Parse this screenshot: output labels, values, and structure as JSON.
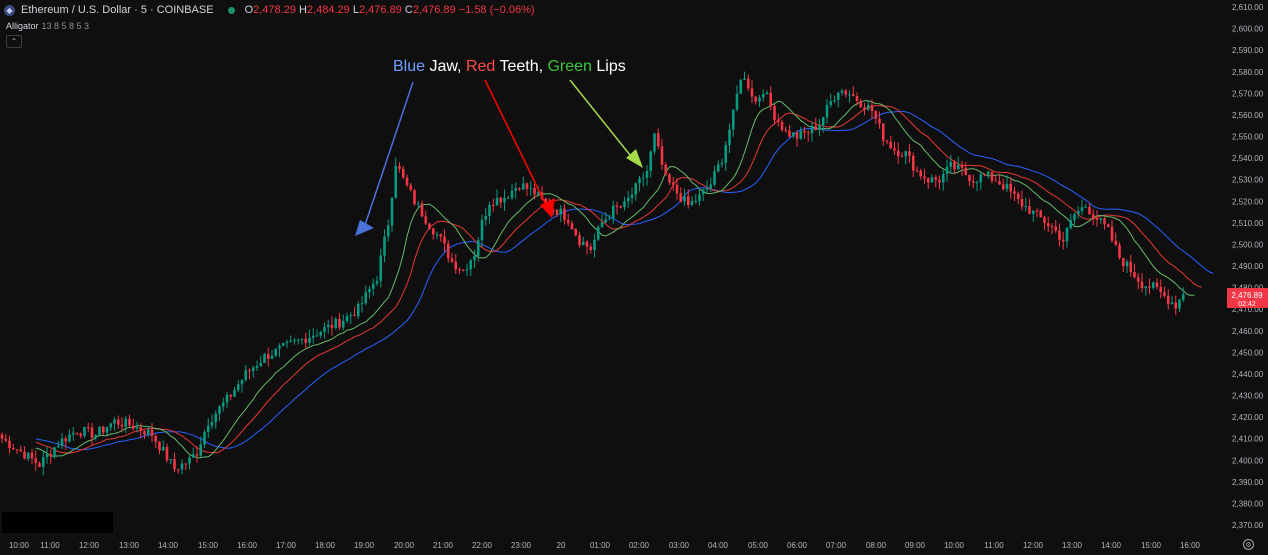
{
  "header": {
    "symbol_icon": "ethereum-icon",
    "symbol": "Ethereum / U.S. Dollar · 5 · COINBASE",
    "open_label": "O",
    "open": "2,478.29",
    "high_label": "H",
    "high": "2,484.29",
    "low_label": "L",
    "low": "2,476.89",
    "close_label": "C",
    "close": "2,476.89",
    "change": "−1.58 (−0.06%)"
  },
  "indicator": {
    "name": "Alligator",
    "params": "13 8 5 8 5 3"
  },
  "annotation": {
    "blue_word": "Blue",
    "jaw": " Jaw, ",
    "red_word": "Red",
    "teeth": " Teeth, ",
    "green_word": "Green",
    "lips": " Lips"
  },
  "price_tag": {
    "price": "2,476.89",
    "countdown": "02:42"
  },
  "colors": {
    "background": "#0f0f0f",
    "up": "#089981",
    "down": "#f23645",
    "jaw": "#2962ff",
    "teeth": "#e53935",
    "lips": "#66bb6a",
    "arrow_blue": "#4a72d8",
    "arrow_red": "#ff0000",
    "arrow_green": "#a6d84a"
  },
  "chart_data": {
    "type": "candlestick",
    "y_ticks": [
      "2,610.00",
      "2,600.00",
      "2,590.00",
      "2,580.00",
      "2,570.00",
      "2,560.00",
      "2,550.00",
      "2,540.00",
      "2,530.00",
      "2,520.00",
      "2,510.00",
      "2,500.00",
      "2,490.00",
      "2,480.00",
      "2,470.00",
      "2,460.00",
      "2,450.00",
      "2,440.00",
      "2,430.00",
      "2,420.00",
      "2,410.00",
      "2,400.00",
      "2,390.00",
      "2,380.00",
      "2,370.00"
    ],
    "x_ticks": [
      "10:00",
      "11:00",
      "12:00",
      "13:00",
      "14:00",
      "15:00",
      "16:00",
      "17:00",
      "18:00",
      "19:00",
      "20:00",
      "21:00",
      "22:00",
      "23:00",
      "20",
      "01:00",
      "02:00",
      "03:00",
      "04:00",
      "05:00",
      "06:00",
      "07:00",
      "08:00",
      "09:00",
      "10:00",
      "11:00",
      "12:00",
      "13:00",
      "14:00",
      "15:00",
      "16:00"
    ],
    "ylim": [
      2370,
      2610
    ],
    "close_path": [
      [
        0,
        2410
      ],
      [
        5,
        2404
      ],
      [
        10,
        2398
      ],
      [
        15,
        2408
      ],
      [
        20,
        2414
      ],
      [
        25,
        2412
      ],
      [
        30,
        2418
      ],
      [
        35,
        2416
      ],
      [
        40,
        2412
      ],
      [
        43,
        2404
      ],
      [
        46,
        2396
      ],
      [
        50,
        2400
      ],
      [
        52,
        2404
      ],
      [
        55,
        2418
      ],
      [
        60,
        2428
      ],
      [
        65,
        2440
      ],
      [
        70,
        2448
      ],
      [
        75,
        2452
      ],
      [
        80,
        2456
      ],
      [
        85,
        2460
      ],
      [
        90,
        2464
      ],
      [
        95,
        2470
      ],
      [
        100,
        2485
      ],
      [
        103,
        2510
      ],
      [
        105,
        2538
      ],
      [
        107,
        2530
      ],
      [
        110,
        2520
      ],
      [
        113,
        2512
      ],
      [
        117,
        2502
      ],
      [
        120,
        2492
      ],
      [
        123,
        2488
      ],
      [
        126,
        2496
      ],
      [
        128,
        2510
      ],
      [
        130,
        2520
      ],
      [
        134,
        2522
      ],
      [
        138,
        2528
      ],
      [
        142,
        2524
      ],
      [
        145,
        2518
      ],
      [
        148,
        2516
      ],
      [
        151,
        2512
      ],
      [
        154,
        2502
      ],
      [
        157,
        2498
      ],
      [
        160,
        2510
      ],
      [
        163,
        2516
      ],
      [
        166,
        2518
      ],
      [
        169,
        2526
      ],
      [
        172,
        2534
      ],
      [
        174,
        2550
      ],
      [
        177,
        2530
      ],
      [
        180,
        2524
      ],
      [
        183,
        2518
      ],
      [
        186,
        2522
      ],
      [
        189,
        2528
      ],
      [
        192,
        2540
      ],
      [
        195,
        2560
      ],
      [
        197,
        2578
      ],
      [
        199,
        2574
      ],
      [
        201,
        2566
      ],
      [
        203,
        2572
      ],
      [
        206,
        2560
      ],
      [
        209,
        2552
      ],
      [
        212,
        2550
      ],
      [
        215,
        2552
      ],
      [
        218,
        2556
      ],
      [
        221,
        2566
      ],
      [
        223,
        2572
      ],
      [
        226,
        2570
      ],
      [
        229,
        2566
      ],
      [
        232,
        2562
      ],
      [
        235,
        2550
      ],
      [
        238,
        2544
      ],
      [
        241,
        2542
      ],
      [
        244,
        2534
      ],
      [
        247,
        2530
      ],
      [
        250,
        2530
      ],
      [
        253,
        2536
      ],
      [
        256,
        2534
      ],
      [
        259,
        2530
      ],
      [
        262,
        2532
      ],
      [
        265,
        2530
      ],
      [
        268,
        2526
      ],
      [
        271,
        2520
      ],
      [
        274,
        2516
      ],
      [
        277,
        2512
      ],
      [
        280,
        2508
      ],
      [
        283,
        2502
      ],
      [
        286,
        2514
      ],
      [
        289,
        2518
      ],
      [
        292,
        2512
      ],
      [
        295,
        2506
      ],
      [
        298,
        2494
      ],
      [
        301,
        2488
      ],
      [
        304,
        2482
      ],
      [
        307,
        2480
      ],
      [
        310,
        2476
      ],
      [
        313,
        2472
      ],
      [
        315,
        2476.89
      ]
    ],
    "series": [
      {
        "name": "Jaw",
        "color": "#2962ff"
      },
      {
        "name": "Teeth",
        "color": "#e53935"
      },
      {
        "name": "Lips",
        "color": "#66bb6a"
      }
    ]
  }
}
